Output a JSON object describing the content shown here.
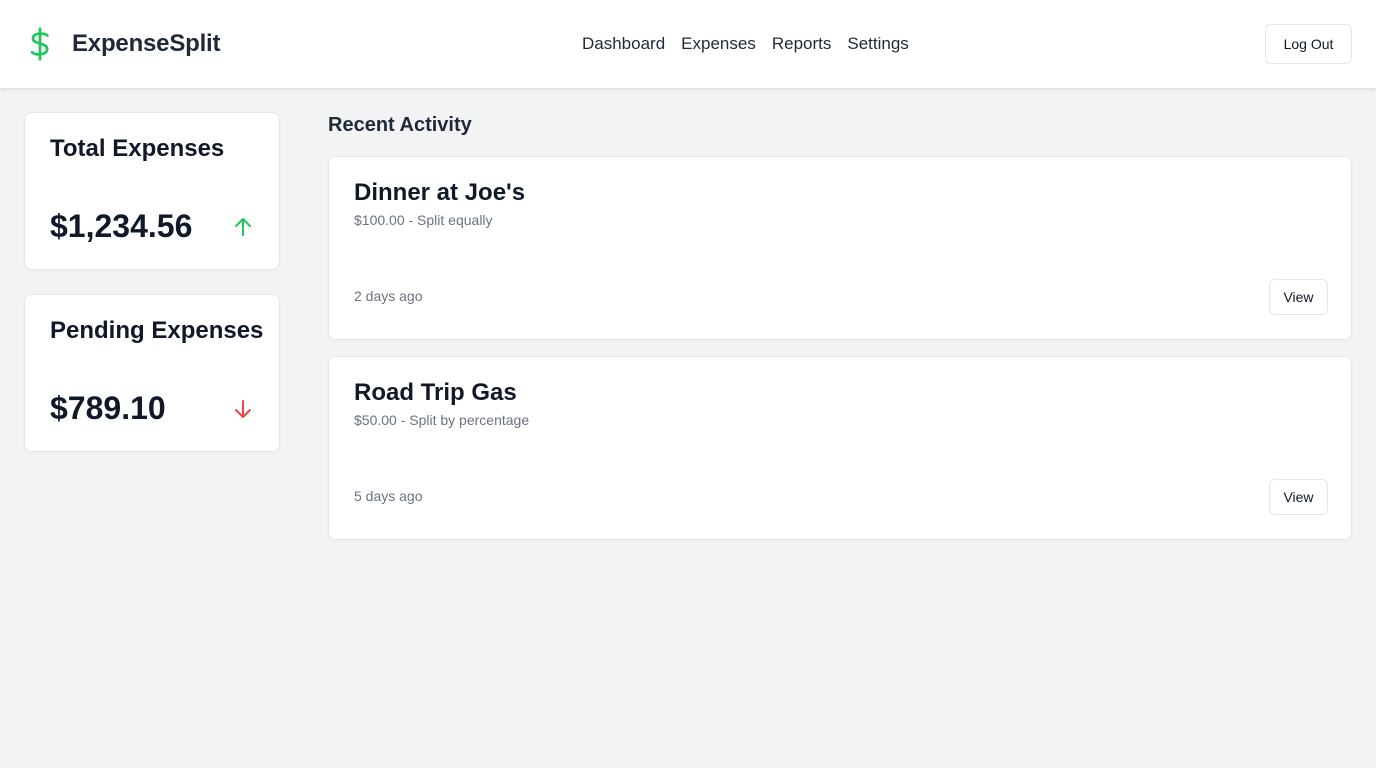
{
  "app": {
    "name": "ExpenseSplit",
    "logo_icon": "dollar-sign-icon",
    "brand_color": "#22c55e"
  },
  "nav": {
    "items": [
      {
        "label": "Dashboard"
      },
      {
        "label": "Expenses"
      },
      {
        "label": "Reports"
      },
      {
        "label": "Settings"
      }
    ],
    "logout_label": "Log Out"
  },
  "stats": [
    {
      "title": "Total Expenses",
      "value": "$1,234.56",
      "trend": "up",
      "trend_icon": "arrow-up-icon",
      "trend_color": "#22c55e"
    },
    {
      "title": "Pending Expenses",
      "value": "$789.10",
      "trend": "down",
      "trend_icon": "arrow-down-icon",
      "trend_color": "#ef4444"
    }
  ],
  "activity": {
    "title": "Recent Activity",
    "items": [
      {
        "title": "Dinner at Joe's",
        "subtitle": "$100.00 - Split equally",
        "time": "2 days ago",
        "action_label": "View"
      },
      {
        "title": "Road Trip Gas",
        "subtitle": "$50.00 - Split by percentage",
        "time": "5 days ago",
        "action_label": "View"
      }
    ]
  }
}
